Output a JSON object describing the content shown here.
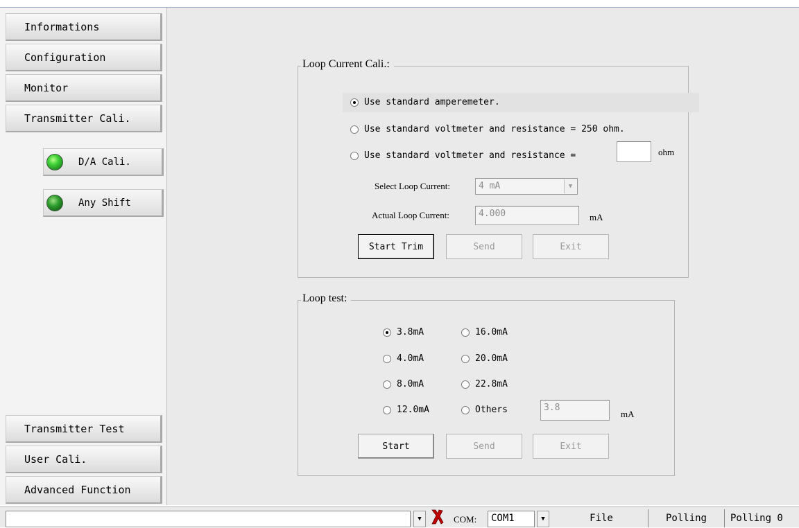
{
  "nav": {
    "items_top": [
      "Informations",
      "Configuration",
      "Monitor",
      "Transmitter Cali."
    ],
    "sub_items": [
      "D/A Cali.",
      "Any Shift"
    ],
    "items_bottom": [
      "Transmitter Test",
      "User Cali.",
      "Advanced Function"
    ]
  },
  "loop_cali": {
    "title": "Loop Current Cali.:",
    "options": [
      "Use standard amperemeter.",
      "Use standard voltmeter and resistance = 250 ohm.",
      "Use standard voltmeter and  resistance ="
    ],
    "resistance_unit": "ohm",
    "resistance_value": "",
    "select_label": "Select Loop Current:",
    "select_value": "4 mA",
    "actual_label": "Actual Loop Current:",
    "actual_value": "4.000",
    "actual_unit": "mA",
    "buttons": [
      "Start Trim",
      "Send",
      "Exit"
    ]
  },
  "loop_test": {
    "title": "Loop test:",
    "options_left": [
      "3.8mA",
      "4.0mA",
      "8.0mA",
      "12.0mA"
    ],
    "options_right": [
      "16.0mA",
      "20.0mA",
      "22.8mA",
      "Others"
    ],
    "others_value": "3.8",
    "others_unit": "mA",
    "buttons": [
      "Start",
      "Send",
      "Exit"
    ]
  },
  "statusbar": {
    "message": "",
    "com_label": "COM:",
    "com_value": "COM1",
    "panels": [
      "File",
      "Polling",
      "Polling 0"
    ]
  },
  "colors": {
    "led_on": "#42d33a",
    "disconnect_icon": "#c00000"
  }
}
